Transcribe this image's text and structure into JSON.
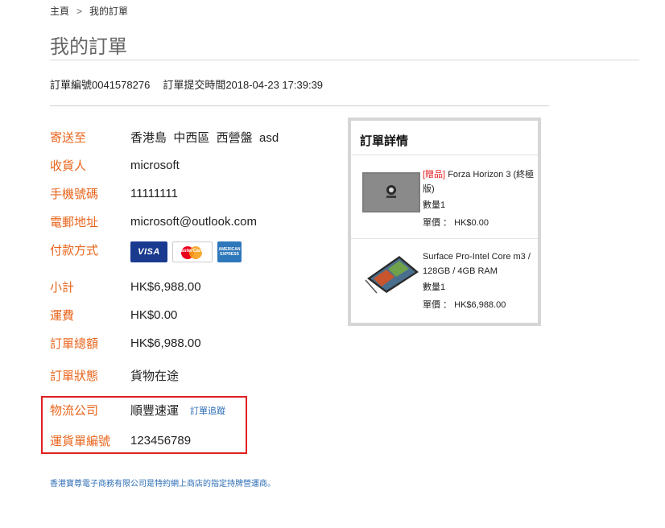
{
  "breadcrumb": {
    "home": "主頁",
    "separator": ">",
    "current": "我的訂單"
  },
  "page_title": "我的訂單",
  "order": {
    "number": "訂單編號0041578276",
    "submitted": "訂單提交時間2018-04-23 17:39:39"
  },
  "fields": {
    "ship_to": {
      "label": "寄送至",
      "value": "香港島  中西區  西營盤  asd"
    },
    "recipient": {
      "label": "收貨人",
      "value": "microsoft"
    },
    "phone": {
      "label": "手機號碼",
      "value": "11111111"
    },
    "email": {
      "label": "電郵地址",
      "value": "microsoft@outlook.com"
    },
    "payment": {
      "label": "付款方式",
      "icons": [
        "visa-icon",
        "mastercard-icon",
        "amex-icon"
      ],
      "visa_text": "VISA",
      "master_text": "MasterCard",
      "amex_text": "AMERICAN EXPRESS"
    },
    "subtotal": {
      "label": "小計",
      "value": "HK$6,988.00"
    },
    "shipping": {
      "label": "運費",
      "value": "HK$0.00"
    },
    "total": {
      "label": "訂單總額",
      "value": "HK$6,988.00"
    },
    "status": {
      "label": "訂單狀態",
      "value": "貨物在途"
    },
    "logistics": {
      "label": "物流公司",
      "value": "順豐速運",
      "track_link": "訂單追蹤"
    },
    "waybill": {
      "label": "運貨單編號",
      "value": "123456789"
    }
  },
  "footer_note": "香港寶尊電子商務有限公司是特約網上商店的指定持牌營運商。",
  "detail": {
    "title": "訂單詳情",
    "items": [
      {
        "gift_tag": "[贈品]",
        "name": "Forza Horizon 3 (終極版)",
        "qty": "數量1",
        "price_label": "單價 ：",
        "price": "HK$0.00"
      },
      {
        "gift_tag": "",
        "name": "Surface Pro-Intel Core m3 / 128GB / 4GB RAM",
        "qty": "數量1",
        "price_label": "單價 ：",
        "price": "HK$6,988.00"
      }
    ]
  },
  "colors": {
    "label_orange": "#e8641b",
    "link_blue": "#2d6db5",
    "highlight_red": "#e02020",
    "panel_border": "#d6d6d6"
  }
}
